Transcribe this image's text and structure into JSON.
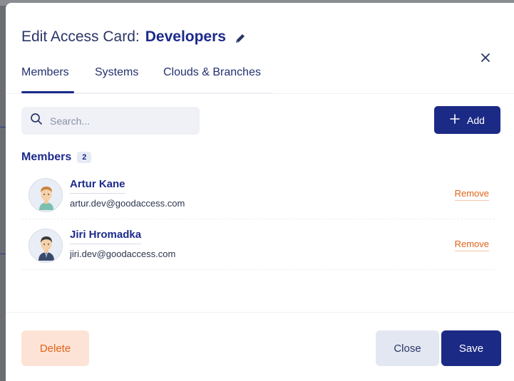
{
  "dialog": {
    "title_prefix": "Edit Access Card:",
    "title_name": "Developers"
  },
  "tabs": [
    {
      "label": "Members",
      "active": true
    },
    {
      "label": "Systems",
      "active": false
    },
    {
      "label": "Clouds & Branches",
      "active": false
    }
  ],
  "search": {
    "placeholder": "Search...",
    "value": ""
  },
  "add_button": {
    "label": "Add"
  },
  "members_section": {
    "title": "Members",
    "count": "2"
  },
  "members": [
    {
      "name": "Artur Kane",
      "email": "artur.dev@goodaccess.com",
      "remove_label": "Remove"
    },
    {
      "name": "Jiri Hromadka",
      "email": "jiri.dev@goodaccess.com",
      "remove_label": "Remove"
    }
  ],
  "footer": {
    "delete_label": "Delete",
    "close_label": "Close",
    "save_label": "Save"
  },
  "colors": {
    "primary": "#1b2a85",
    "danger": "#e0631a",
    "danger_bg": "#fde3d6",
    "secondary_bg": "#e3e7f2"
  },
  "icons": {
    "edit": "pencil-icon",
    "close": "close-icon",
    "search": "search-icon",
    "add": "plus-icon"
  }
}
